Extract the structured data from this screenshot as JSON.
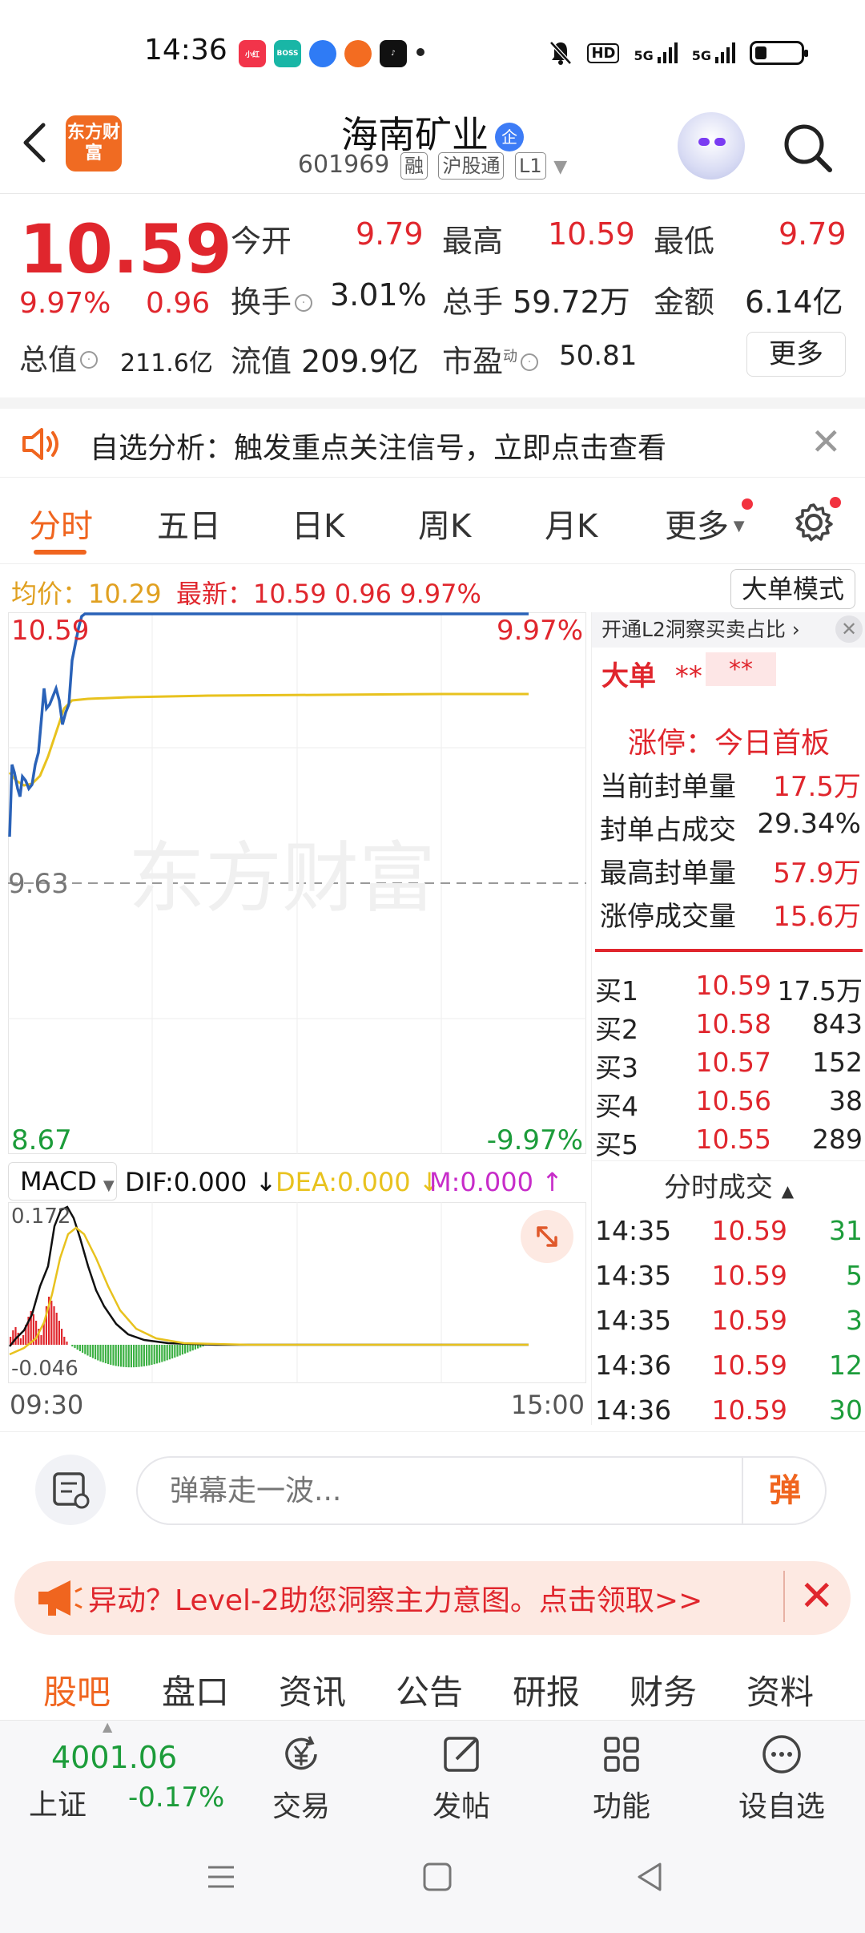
{
  "status_bar": {
    "time": "14:36",
    "network": "5G",
    "hd": "HD"
  },
  "header": {
    "logo_text": "东方财富",
    "stock_name": "海南矿业",
    "verify_badge": "企",
    "code": "601969",
    "tags": [
      "融",
      "沪股通",
      "L1"
    ]
  },
  "quote": {
    "price": "10.59",
    "change_pct": "9.97%",
    "change": "0.96",
    "open_label": "今开",
    "open": "9.79",
    "high_label": "最高",
    "high": "10.59",
    "low_label": "最低",
    "low": "9.79",
    "turnover_label": "换手",
    "turnover": "3.01%",
    "volume_label": "总手",
    "volume": "59.72万",
    "amount_label": "金额",
    "amount": "6.14亿",
    "total_value_label": "总值",
    "total_value": "211.6亿",
    "float_value_label": "流值",
    "float_value": "209.9亿",
    "pe_label": "市盈",
    "pe_sup": "动",
    "pe": "50.81",
    "more_label": "更多"
  },
  "alert": {
    "text": "自选分析：触发重点关注信号，立即点击查看",
    "close": "✕"
  },
  "chart_tabs": [
    "分时",
    "五日",
    "日K",
    "周K",
    "月K",
    "更多"
  ],
  "chart_info": {
    "avg": "均价：10.29",
    "latest": "最新：10.59  0.96  9.97%",
    "big_order_mode": "大单模式"
  },
  "price_chart": {
    "y_top": "10.59",
    "y_top_pct": "9.97%",
    "y_mid": "9.63",
    "y_bottom": "8.67",
    "y_bottom_pct": "-9.97%",
    "watermark": "东方财富"
  },
  "macd": {
    "select_label": "MACD",
    "dif": "DIF:0.000",
    "dea": "DEA:0.000",
    "m": "M:0.000",
    "y_top": "0.172",
    "y_bottom": "-0.046"
  },
  "time_axis": {
    "start": "09:30",
    "end": "15:00"
  },
  "right_panel": {
    "l2_text": "开通L2洞察买卖占比",
    "big_order_label": "大单",
    "big_order_v1": "**",
    "big_order_v2": "**",
    "limit_title": "涨停：今日首板",
    "limit_rows": [
      {
        "label": "当前封单量",
        "value": "17.5万"
      },
      {
        "label": "封单占成交",
        "value": "29.34%"
      },
      {
        "label": "最高封单量",
        "value": "57.9万"
      },
      {
        "label": "涨停成交量",
        "value": "15.6万"
      }
    ],
    "bids": [
      {
        "label": "买1",
        "price": "10.59",
        "vol": "17.5万"
      },
      {
        "label": "买2",
        "price": "10.58",
        "vol": "843"
      },
      {
        "label": "买3",
        "price": "10.57",
        "vol": "152"
      },
      {
        "label": "买4",
        "price": "10.56",
        "vol": "38"
      },
      {
        "label": "买5",
        "price": "10.55",
        "vol": "289"
      }
    ],
    "ticks_title": "分时成交",
    "ticks": [
      {
        "time": "14:35",
        "price": "10.59",
        "vol": "31"
      },
      {
        "time": "14:35",
        "price": "10.59",
        "vol": "5"
      },
      {
        "time": "14:35",
        "price": "10.59",
        "vol": "3"
      },
      {
        "time": "14:36",
        "price": "10.59",
        "vol": "12"
      },
      {
        "time": "14:36",
        "price": "10.59",
        "vol": "30"
      }
    ]
  },
  "comment": {
    "placeholder": "弹幕走一波...",
    "danmu": "弹"
  },
  "promo": {
    "text": "异动？Level-2助您洞察主力意图。点击领取>>"
  },
  "community_tabs": [
    "股吧",
    "盘口",
    "资讯",
    "公告",
    "研报",
    "财务",
    "资料"
  ],
  "bottom_bar": {
    "index_value": "4001.06",
    "index_name": "上证",
    "index_change": "-0.17%",
    "items": [
      "交易",
      "发帖",
      "功能",
      "设自选"
    ]
  },
  "colors": {
    "up": "#e0262d",
    "down": "#1c9c3a",
    "accent": "#f0651f",
    "price_line": "#2a62b8",
    "avg_line": "#e8c21e"
  }
}
